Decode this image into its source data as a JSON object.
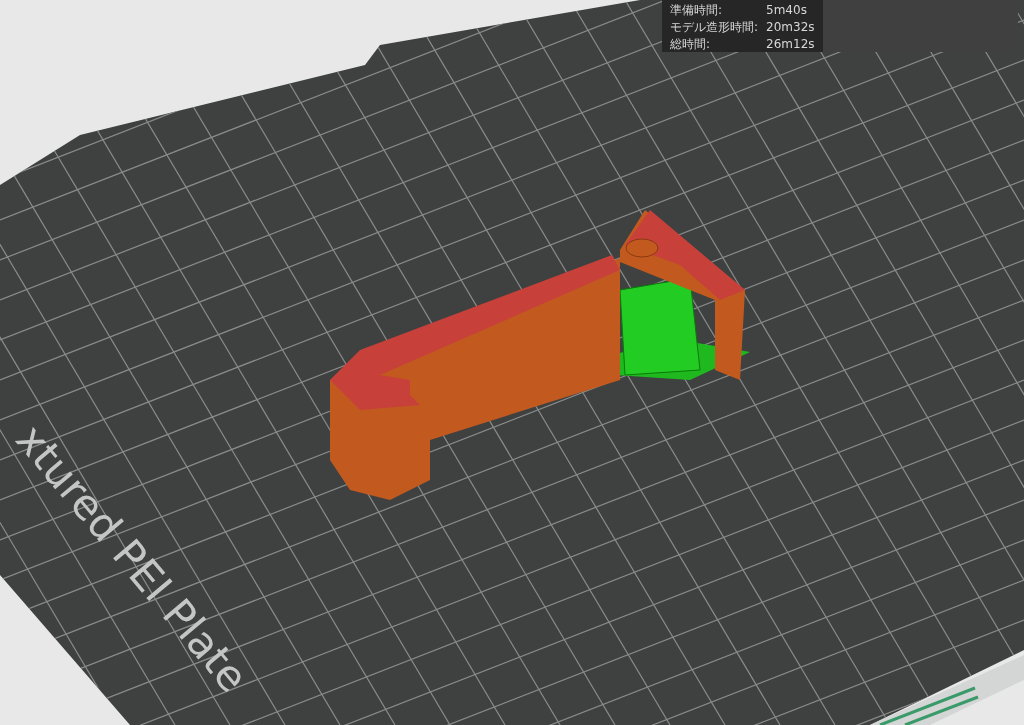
{
  "plate": {
    "label": "xtured PEI Plate"
  },
  "stats": [
    {
      "label": "準備時間:",
      "value": "5m40s"
    },
    {
      "label": "モデル造形時間:",
      "value": "20m32s"
    },
    {
      "label": "総時間:",
      "value": "26m12s"
    }
  ]
}
